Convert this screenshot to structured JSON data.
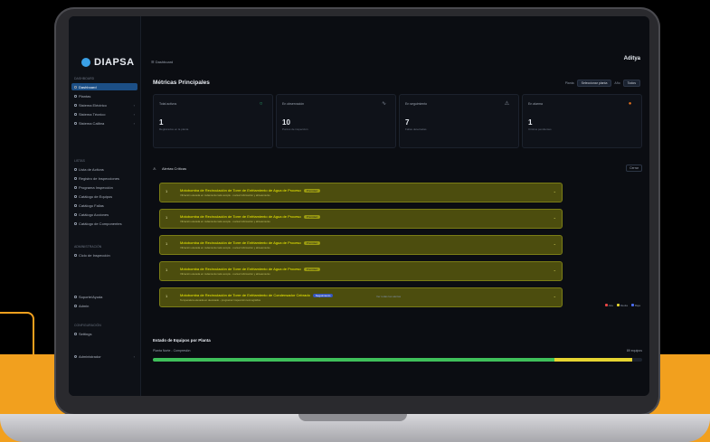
{
  "sidebar": {
    "logo_text": "DIAPSA",
    "groups": [
      {
        "label": "Dashboard",
        "items": [
          {
            "label": "Dashboard",
            "active": true
          },
          {
            "label": "Plantas"
          },
          {
            "label": "Sistema Eléctrico"
          },
          {
            "label": "Sistema Técnico"
          },
          {
            "label": "Sistema Calibra"
          }
        ]
      },
      {
        "label": "Listas",
        "items": [
          {
            "label": "Lista de Activos"
          },
          {
            "label": "Registro de Inspecciones"
          },
          {
            "label": "Programa Inspección"
          },
          {
            "label": "Catálogo de Equipos"
          },
          {
            "label": "Catálogo Fallas"
          },
          {
            "label": "Catálogo Acciones"
          },
          {
            "label": "Catálogo de Componentes"
          }
        ]
      },
      {
        "label": "Administración",
        "items": [
          {
            "label": "Ciclo de Inspección"
          }
        ]
      }
    ],
    "bottom": [
      {
        "label": "Soporte/Ayuda"
      },
      {
        "label": "Admin"
      }
    ],
    "footer_label": "Configuración",
    "settings": "Settings",
    "user": "Administrador"
  },
  "header": {
    "breadcrumb": "Dashboard",
    "brand": "Aditya"
  },
  "page": {
    "title": "Métricas Principales",
    "filter_label": "Planta",
    "filter_value": "Seleccionar planta",
    "filter2_label": "Año",
    "filter2_value": "Todos"
  },
  "cards": [
    {
      "title": "Total activos",
      "value": "1",
      "sub": "Registrados en la planta",
      "color": "#2bb673",
      "icon": "○"
    },
    {
      "title": "En observación",
      "value": "10",
      "sub": "Puntos de inspección",
      "color": "#8a93a1",
      "icon": "∿"
    },
    {
      "title": "En seguimiento",
      "value": "7",
      "sub": "Fallas detectadas",
      "color": "#8a93a1",
      "icon": "⚠"
    },
    {
      "title": "En alarma",
      "value": "1",
      "sub": "Críticos pendientes",
      "color": "#e8731c",
      "icon": "●"
    }
  ],
  "alerts_section": {
    "title": "Alertas Críticas",
    "button": "Cerrar",
    "items": [
      {
        "num": "1",
        "text": "Motobomba de Recirculación de Torre de Enfriamiento de Agua de Proceso",
        "badge": "Prioridad",
        "badge_style": "yellow",
        "sub": "Vibración elevada en rodamiento lado acople - revisar lubricación y alineamiento"
      },
      {
        "num": "1",
        "text": "Motobomba de Recirculación de Torre de Enfriamiento de Agua de Proceso",
        "badge": "Prioridad",
        "badge_style": "yellow",
        "sub": "Vibración elevada en rodamiento lado acople - revisar lubricación y alineamiento"
      },
      {
        "num": "1",
        "text": "Motobomba de Recirculación de Torre de Enfriamiento de Agua de Proceso",
        "badge": "Prioridad",
        "badge_style": "yellow",
        "sub": "Vibración elevada en rodamiento lado acople - revisar lubricación y alineamiento"
      },
      {
        "num": "1",
        "text": "Motobomba de Recirculación de Torre de Enfriamiento de Agua de Proceso",
        "badge": "Prioridad",
        "badge_style": "yellow",
        "sub": "Vibración elevada en rodamiento lado acople - revisar lubricación y alineamiento"
      },
      {
        "num": "1",
        "text": "Motobomba de Recirculación de Torre de Enfriamiento de Condensador Cebrado",
        "badge": "Seguimiento",
        "badge_style": "blue",
        "sub": "Temperatura elevada en devanado - programar inspección termográfica"
      }
    ],
    "more": "Ver todas las alertas"
  },
  "legend": [
    {
      "label": "Alta",
      "color": "#e84545"
    },
    {
      "label": "Media",
      "color": "#e6d431"
    },
    {
      "label": "Baja",
      "color": "#4a6cf0"
    }
  ],
  "plan": {
    "title": "Estado de Equipos por Planta",
    "row_label": "Planta Norte - Compresión",
    "row_value": "89 equipos",
    "green_fraction": 0.82,
    "yellow_fraction": 0.16
  }
}
